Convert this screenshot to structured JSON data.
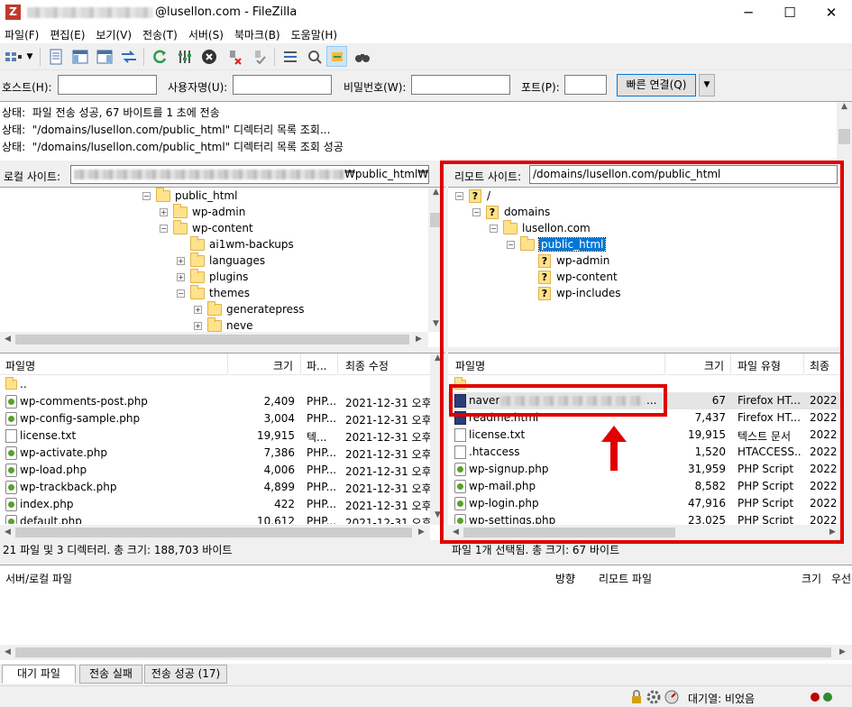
{
  "window": {
    "title_suffix": "@lusellon.com - FileZilla",
    "minimize": "─",
    "maximize": "☐",
    "close": "✕"
  },
  "menu": [
    "파일(F)",
    "편집(E)",
    "보기(V)",
    "전송(T)",
    "서버(S)",
    "북마크(B)",
    "도움말(H)"
  ],
  "quickconnect": {
    "host_label": "호스트(H):",
    "user_label": "사용자명(U):",
    "pass_label": "비밀번호(W):",
    "port_label": "포트(P):",
    "connect_label": "빠른 연결(Q)"
  },
  "log": [
    {
      "prefix": "상태:",
      "text": "파일 전송 성공, 67 바이트를 1 초에 전송"
    },
    {
      "prefix": "상태:",
      "text": "\"/domains/lusellon.com/public_html\" 디렉터리 목록 조회..."
    },
    {
      "prefix": "상태:",
      "text": "\"/domains/lusellon.com/public_html\" 디렉터리 목록 조회 성공"
    }
  ],
  "local": {
    "site_label": "로컬 사이트:",
    "path_tail": "₩public_html₩",
    "tree": [
      {
        "name": "public_html",
        "expander": "minus"
      },
      {
        "name": "wp-admin",
        "expander": "plus"
      },
      {
        "name": "wp-content",
        "expander": "minus"
      },
      {
        "name": "ai1wm-backups",
        "expander": "none"
      },
      {
        "name": "languages",
        "expander": "plus"
      },
      {
        "name": "plugins",
        "expander": "plus"
      },
      {
        "name": "themes",
        "expander": "minus"
      },
      {
        "name": "generatepress",
        "expander": "plus"
      },
      {
        "name": "neve",
        "expander": "plus"
      }
    ],
    "columns": {
      "name": "파일명",
      "size": "크기",
      "type": "파...",
      "modified": "최종 수정"
    },
    "files": [
      {
        "name": "..",
        "size": "",
        "type": "",
        "modified": "",
        "icon": "folder"
      },
      {
        "name": "wp-comments-post.php",
        "size": "2,409",
        "type": "PHP...",
        "modified": "2021-12-31 오후",
        "icon": "php"
      },
      {
        "name": "wp-config-sample.php",
        "size": "3,004",
        "type": "PHP...",
        "modified": "2021-12-31 오후",
        "icon": "php"
      },
      {
        "name": "license.txt",
        "size": "19,915",
        "type": "텍...",
        "modified": "2021-12-31 오후",
        "icon": "doc"
      },
      {
        "name": "wp-activate.php",
        "size": "7,386",
        "type": "PHP...",
        "modified": "2021-12-31 오후",
        "icon": "php"
      },
      {
        "name": "wp-load.php",
        "size": "4,006",
        "type": "PHP...",
        "modified": "2021-12-31 오후",
        "icon": "php"
      },
      {
        "name": "wp-trackback.php",
        "size": "4,899",
        "type": "PHP...",
        "modified": "2021-12-31 오후",
        "icon": "php"
      },
      {
        "name": "index.php",
        "size": "422",
        "type": "PHP...",
        "modified": "2021-12-31 오후",
        "icon": "php"
      },
      {
        "name": "default.php",
        "size": "10,612",
        "type": "PHP...",
        "modified": "2021-12-31 오후",
        "icon": "php"
      }
    ],
    "status": "21 파일 및 3 디렉터리. 총 크기: 188,703 바이트"
  },
  "remote": {
    "site_label": "리모트 사이트:",
    "path": "/domains/lusellon.com/public_html",
    "tree": [
      {
        "name": "/",
        "icon": "q"
      },
      {
        "name": "domains",
        "icon": "q"
      },
      {
        "name": "lusellon.com",
        "icon": "folder"
      },
      {
        "name": "public_html",
        "icon": "folder",
        "selected": true
      },
      {
        "name": "wp-admin",
        "icon": "q"
      },
      {
        "name": "wp-content",
        "icon": "q"
      },
      {
        "name": "wp-includes",
        "icon": "q"
      }
    ],
    "columns": {
      "name": "파일명",
      "size": "크기",
      "type": "파일 유형",
      "modified": "최종"
    },
    "files": [
      {
        "name": "..",
        "size": "",
        "type": "",
        "modified": "",
        "icon": "folder"
      },
      {
        "name": "naver",
        "name_suffix": "...",
        "size": "67",
        "type": "Firefox HT...",
        "modified": "2022",
        "icon": "html",
        "selected": true,
        "blurred": true
      },
      {
        "name": "readme.html",
        "size": "7,437",
        "type": "Firefox HT...",
        "modified": "2022",
        "icon": "html"
      },
      {
        "name": "license.txt",
        "size": "19,915",
        "type": "텍스트 문서",
        "modified": "2022",
        "icon": "doc"
      },
      {
        "name": ".htaccess",
        "size": "1,520",
        "type": "HTACCESS...",
        "modified": "2022",
        "icon": "doc"
      },
      {
        "name": "wp-signup.php",
        "size": "31,959",
        "type": "PHP Script",
        "modified": "2022",
        "icon": "php"
      },
      {
        "name": "wp-mail.php",
        "size": "8,582",
        "type": "PHP Script",
        "modified": "2022",
        "icon": "php"
      },
      {
        "name": "wp-login.php",
        "size": "47,916",
        "type": "PHP Script",
        "modified": "2022",
        "icon": "php"
      },
      {
        "name": "wp-settings.php",
        "size": "23,025",
        "type": "PHP Script",
        "modified": "2022",
        "icon": "php"
      }
    ],
    "status": "파일 1개 선택됨. 총 크기: 67 바이트"
  },
  "queue": {
    "col_server_local": "서버/로컬 파일",
    "col_direction": "방향",
    "col_remote": "리모트 파일",
    "col_size": "크기",
    "col_priority": "우선"
  },
  "tabs": [
    "대기 파일",
    "전송 실패",
    "전송 성공 (17)"
  ],
  "statusbar": {
    "queue_text": "대기열: 비었음"
  },
  "annotation_color": "#e00000"
}
